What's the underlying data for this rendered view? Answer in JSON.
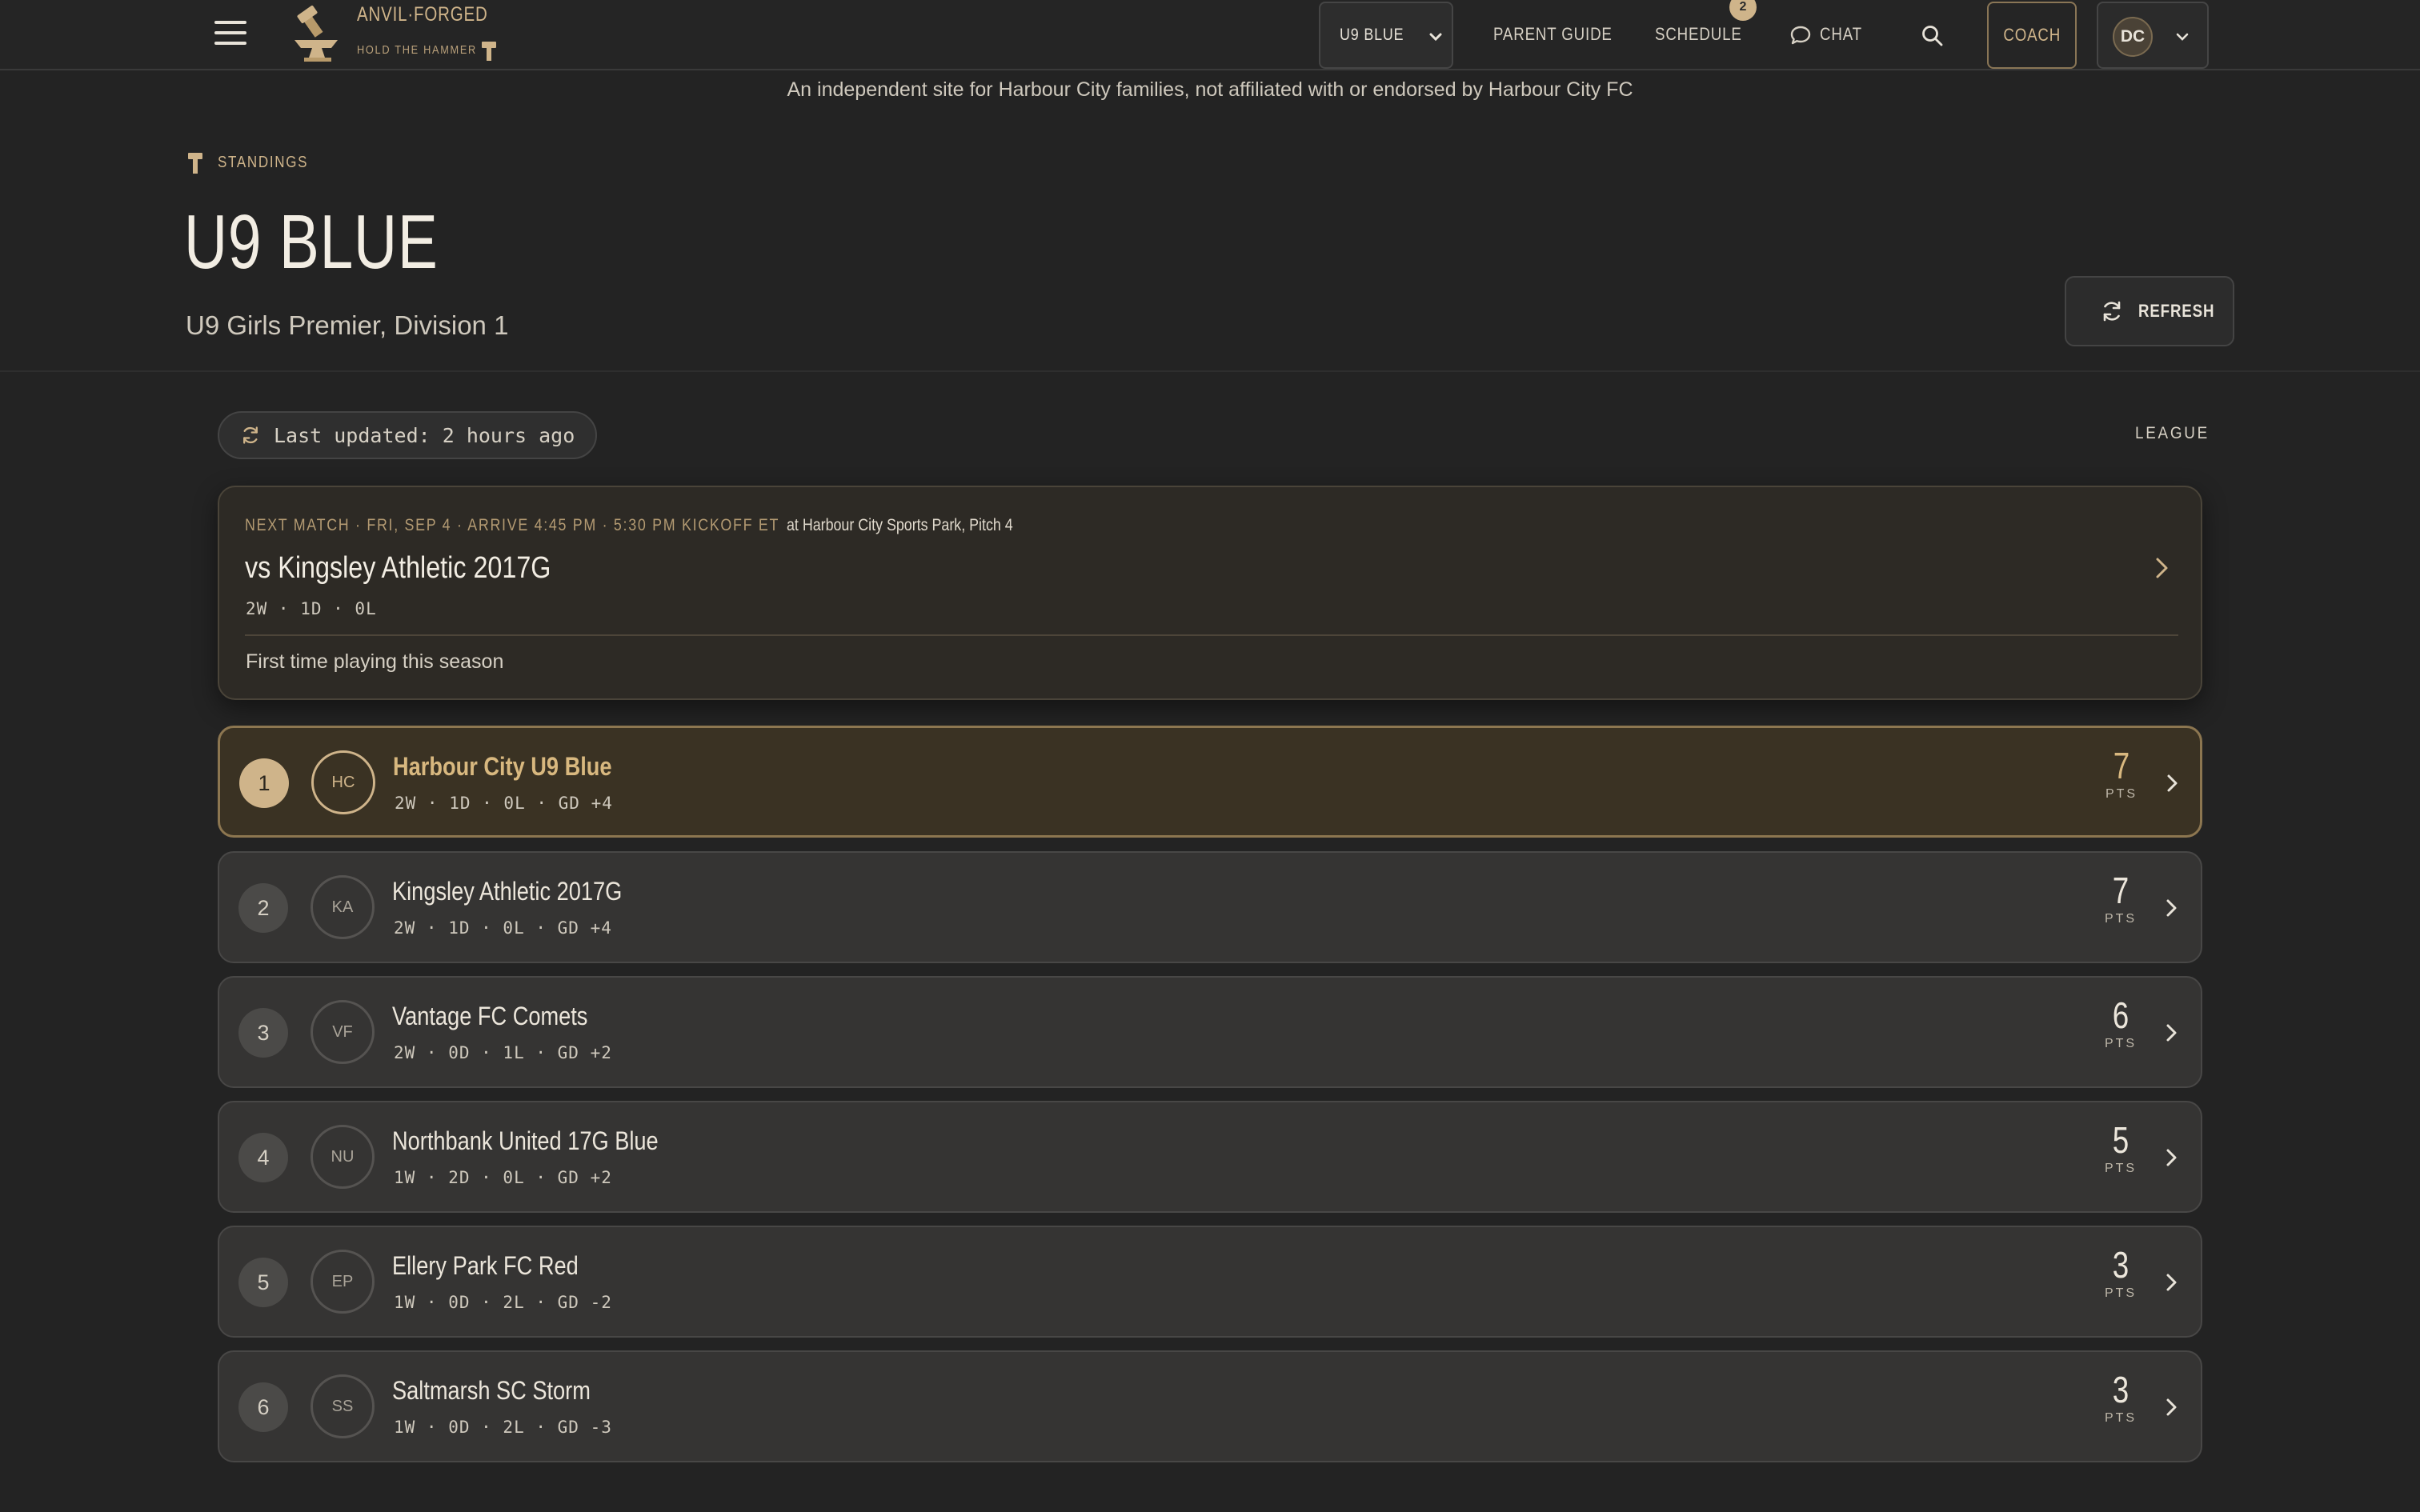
{
  "header": {
    "brand_name": "ANVIL·FORGED",
    "brand_tagline": "HOLD THE HAMMER",
    "team_select": "U9 BLUE",
    "nav": [
      {
        "label": "PARENT GUIDE"
      },
      {
        "label": "SCHEDULE",
        "badge": "2"
      },
      {
        "label": "CHAT"
      }
    ],
    "coach_label": "COACH",
    "user_initials": "DC"
  },
  "disclaimer": "An independent site for Harbour City families, not affiliated with or endorsed by Harbour City FC",
  "page": {
    "breadcrumb": "STANDINGS",
    "title": "U9 BLUE",
    "subtitle": "U9 Girls Premier, Division 1",
    "refresh_label": "REFRESH"
  },
  "status": {
    "last_updated": "Last updated: 2 hours ago",
    "league_label": "LEAGUE"
  },
  "next_match": {
    "when": "NEXT MATCH · FRI, SEP 4 · ARRIVE 4:45 PM · 5:30 PM KICKOFF ET",
    "where": "at Harbour City Sports Park, Pitch 4",
    "opponent": "vs Kingsley Athletic 2017G",
    "record": "2W · 1D · 0L",
    "note": "First time playing this season"
  },
  "standings": [
    {
      "rank": "1",
      "initials": "HC",
      "name": "Harbour City U9 Blue",
      "record": "2W · 1D · 0L · GD +4",
      "pts": "7",
      "pts_label": "PTS"
    },
    {
      "rank": "2",
      "initials": "KA",
      "name": "Kingsley Athletic 2017G",
      "record": "2W · 1D · 0L · GD +4",
      "pts": "7",
      "pts_label": "PTS"
    },
    {
      "rank": "3",
      "initials": "VF",
      "name": "Vantage FC Comets",
      "record": "2W · 0D · 1L · GD +2",
      "pts": "6",
      "pts_label": "PTS"
    },
    {
      "rank": "4",
      "initials": "NU",
      "name": "Northbank United 17G Blue",
      "record": "1W · 2D · 0L · GD +2",
      "pts": "5",
      "pts_label": "PTS"
    },
    {
      "rank": "5",
      "initials": "EP",
      "name": "Ellery Park FC Red",
      "record": "1W · 0D · 2L · GD -2",
      "pts": "3",
      "pts_label": "PTS"
    },
    {
      "rank": "6",
      "initials": "SS",
      "name": "Saltmarsh SC Storm",
      "record": "1W · 0D · 2L · GD -3",
      "pts": "3",
      "pts_label": "PTS"
    }
  ],
  "colors": {
    "background": "#232323",
    "accent": "#cfb48a",
    "card": "#353433",
    "highlight_card": "#3a3223"
  }
}
